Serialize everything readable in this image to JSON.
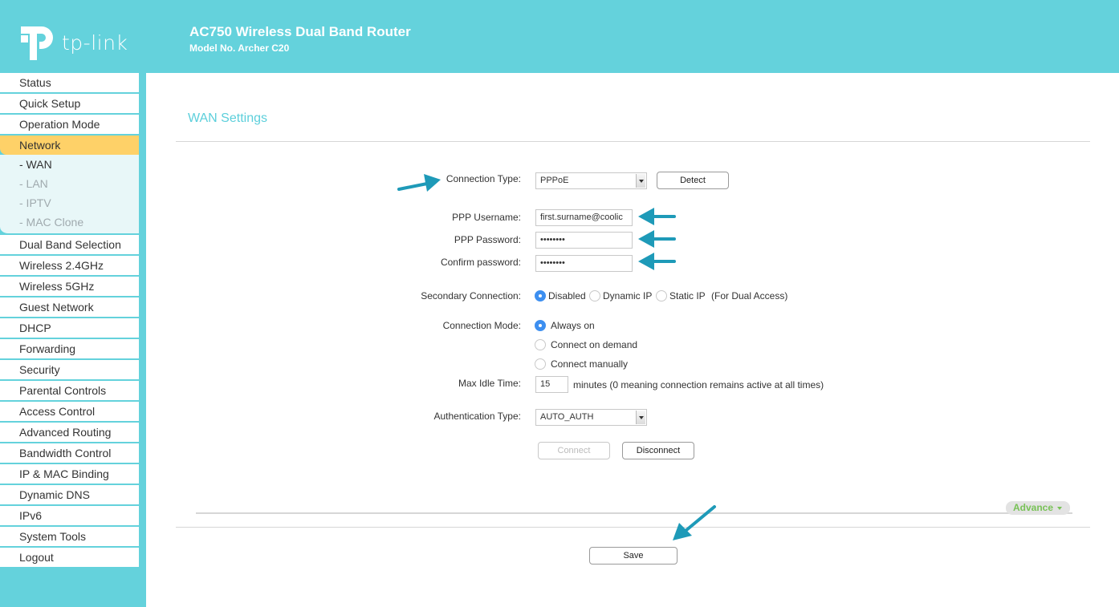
{
  "header": {
    "brand": "tp-link",
    "title": "AC750 Wireless Dual Band Router",
    "model": "Model No. Archer C20"
  },
  "colors": {
    "brand_teal": "#64d2dc",
    "active_menu": "#fed168",
    "radio_selected": "#3d8ff0",
    "advance_green": "#78c256",
    "annotation_arrow": "#1e9ab8"
  },
  "sidebar": {
    "items_before": [
      {
        "label": "Status"
      },
      {
        "label": "Quick Setup"
      },
      {
        "label": "Operation Mode"
      }
    ],
    "active": {
      "label": "Network"
    },
    "submenu": [
      {
        "label": "- WAN",
        "current": true
      },
      {
        "label": "- LAN",
        "current": false
      },
      {
        "label": "- IPTV",
        "current": false
      },
      {
        "label": "- MAC Clone",
        "current": false
      }
    ],
    "items_after": [
      {
        "label": "Dual Band Selection"
      },
      {
        "label": "Wireless 2.4GHz"
      },
      {
        "label": "Wireless 5GHz"
      },
      {
        "label": "Guest Network"
      },
      {
        "label": "DHCP"
      },
      {
        "label": "Forwarding"
      },
      {
        "label": "Security"
      },
      {
        "label": "Parental Controls"
      },
      {
        "label": "Access Control"
      },
      {
        "label": "Advanced Routing"
      },
      {
        "label": "Bandwidth Control"
      },
      {
        "label": "IP & MAC Binding"
      },
      {
        "label": "Dynamic DNS"
      },
      {
        "label": "IPv6"
      },
      {
        "label": "System Tools"
      },
      {
        "label": "Logout"
      }
    ]
  },
  "main": {
    "page_title": "WAN Settings",
    "connection_type": {
      "label": "Connection Type:",
      "value": "PPPoE",
      "detect_label": "Detect"
    },
    "ppp_username": {
      "label": "PPP Username:",
      "value": "first.surname@coolic"
    },
    "ppp_password": {
      "label": "PPP Password:",
      "value": "••••••••"
    },
    "confirm_password": {
      "label": "Confirm password:",
      "value": "••••••••"
    },
    "secondary_connection": {
      "label": "Secondary Connection:",
      "options": [
        {
          "label": "Disabled",
          "selected": true
        },
        {
          "label": "Dynamic IP",
          "selected": false
        },
        {
          "label": "Static IP",
          "selected": false
        }
      ],
      "note": "(For Dual Access)"
    },
    "connection_mode": {
      "label": "Connection Mode:",
      "options": [
        {
          "label": "Always on",
          "selected": true
        },
        {
          "label": "Connect on demand",
          "selected": false
        },
        {
          "label": "Connect manually",
          "selected": false
        }
      ]
    },
    "max_idle_time": {
      "label": "Max Idle Time:",
      "value": "15",
      "unit_note": "minutes (0 meaning connection remains active at all times)"
    },
    "authentication_type": {
      "label": "Authentication Type:",
      "value": "AUTO_AUTH"
    },
    "connect_label": "Connect",
    "disconnect_label": "Disconnect",
    "advance_label": "Advance",
    "save_label": "Save"
  }
}
